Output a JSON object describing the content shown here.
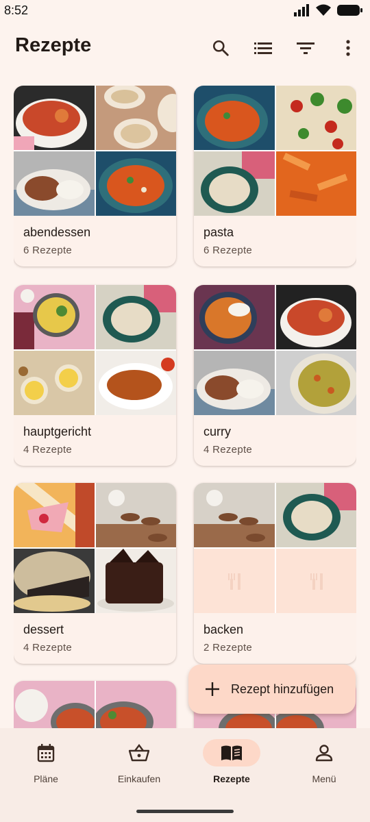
{
  "status_bar": {
    "time": "8:52"
  },
  "header": {
    "title": "Rezepte"
  },
  "icons": {
    "search": "search-icon",
    "list": "list-view-icon",
    "filter": "filter-icon",
    "more": "more-vert-icon",
    "fab": "plus-icon"
  },
  "cards": [
    {
      "title": "abendessen",
      "count": "6 Rezepte"
    },
    {
      "title": "pasta",
      "count": "6 Rezepte"
    },
    {
      "title": "hauptgericht",
      "count": "4 Rezepte"
    },
    {
      "title": "curry",
      "count": "4 Rezepte"
    },
    {
      "title": "dessert",
      "count": "4 Rezepte"
    },
    {
      "title": "backen",
      "count": "2 Rezepte"
    }
  ],
  "fab": {
    "label": "Rezept hinzufügen"
  },
  "nav": {
    "items": [
      {
        "label": "Pläne",
        "icon": "calendar-icon"
      },
      {
        "label": "Einkaufen",
        "icon": "basket-icon"
      },
      {
        "label": "Rezepte",
        "icon": "book-icon"
      },
      {
        "label": "Menü",
        "icon": "person-icon"
      }
    ],
    "active_index": 2
  },
  "colors": {
    "background": "#fdf3ee",
    "fab": "#fdd8c8",
    "active_nav_pill": "#fdd8c8",
    "text": "#221a16"
  }
}
